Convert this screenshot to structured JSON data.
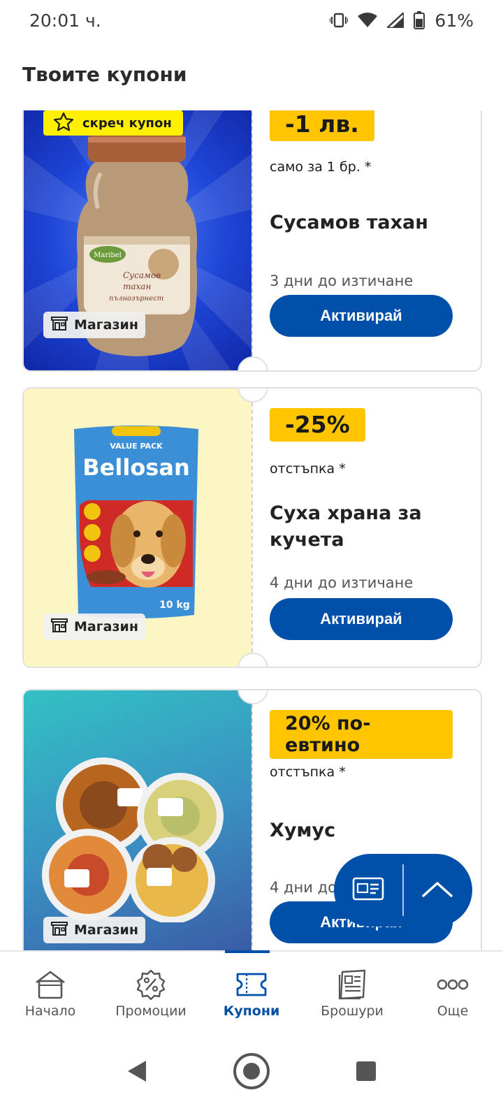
{
  "status_bar": {
    "time": "20:01 ч.",
    "battery": "61%"
  },
  "header": {
    "title": "Твоите купони"
  },
  "colors": {
    "brand_blue": "#0050aa",
    "badge_yellow": "#ffc500",
    "scratch_yellow": "#fff000"
  },
  "coupons": [
    {
      "badge_label": "скреч купон",
      "discount": "-1 лв.",
      "discount_note": "само за 1 бр. *",
      "product": "Сусамов тахан",
      "expiry": "3 дни до изтичане",
      "action_label": "Активирай",
      "store_label": "Магазин",
      "jar_label_brand": "Maribel",
      "jar_label_text": "Сусамов тахан пълнозърнест"
    },
    {
      "discount": "-25%",
      "discount_note": "отстъпка *",
      "product": "Суха храна за кучета",
      "expiry": "4 дни до изтичане",
      "action_label": "Активирай",
      "store_label": "Магазин",
      "bag_brand": "Bellosan",
      "bag_pack": "VALUE PACK",
      "bag_weight": "10 kg"
    },
    {
      "discount": "20% по-евтино",
      "discount_note": "отстъпка *",
      "product": "Хумус",
      "expiry": "4 дни до изтичане",
      "action_label": "Активирай",
      "store_label": "Магазин"
    }
  ],
  "fab": {
    "card_icon": "card-icon",
    "up_icon": "chevron-up-icon"
  },
  "bottom_nav": [
    {
      "label": "Начало",
      "icon": "home-icon"
    },
    {
      "label": "Промоции",
      "icon": "percent-badge-icon"
    },
    {
      "label": "Купони",
      "icon": "coupon-icon",
      "active": true
    },
    {
      "label": "Брошури",
      "icon": "brochure-icon"
    },
    {
      "label": "Още",
      "icon": "more-dots-icon"
    }
  ]
}
